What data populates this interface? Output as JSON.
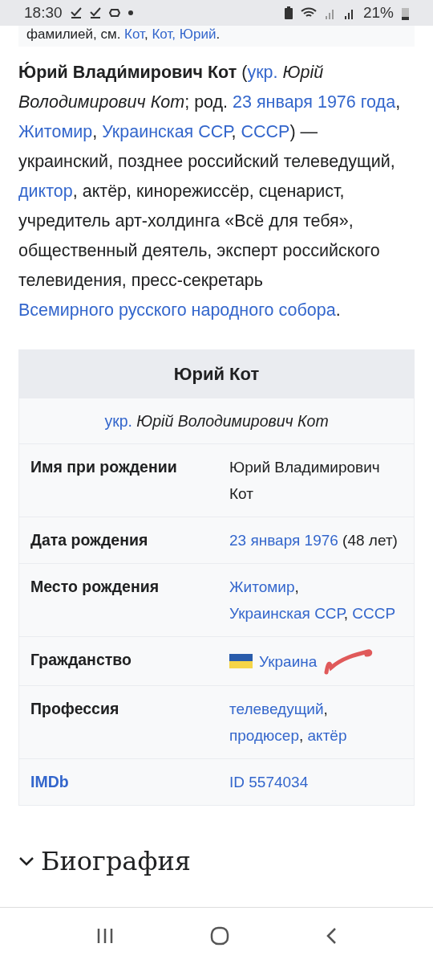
{
  "status_bar": {
    "time": "18:30",
    "battery": "21%"
  },
  "notice": [
    {
      "kind": "text",
      "t": "фамилией, см. "
    },
    {
      "kind": "link",
      "t": "Кот"
    },
    {
      "kind": "text",
      "t": ", "
    },
    {
      "kind": "link",
      "t": "Кот, Юрий"
    },
    {
      "kind": "text",
      "t": "."
    }
  ],
  "intro": [
    {
      "kind": "bold",
      "t": "Ю́рий Влади́мирович Кот"
    },
    {
      "kind": "text",
      "t": " ("
    },
    {
      "kind": "link",
      "t": "укр."
    },
    {
      "kind": "italic",
      "t": " Юрій Володимирович Кот"
    },
    {
      "kind": "text",
      "t": "; род. "
    },
    {
      "kind": "link",
      "t": "23 января 1976 года"
    },
    {
      "kind": "text",
      "t": ", "
    },
    {
      "kind": "link",
      "t": "Житомир"
    },
    {
      "kind": "text",
      "t": ", "
    },
    {
      "kind": "link",
      "t": "Украинская ССР"
    },
    {
      "kind": "text",
      "t": ", "
    },
    {
      "kind": "link",
      "t": "СССР"
    },
    {
      "kind": "text",
      "t": ") — украинский, позднее российский телеведущий, "
    },
    {
      "kind": "link",
      "t": "диктор"
    },
    {
      "kind": "text",
      "t": ", актёр, кинорежиссёр, сценарист, учредитель арт-холдинга «Всё для тебя», общественный деятель, эксперт российского телевидения, пресс-секретарь "
    },
    {
      "kind": "link",
      "t": "Всемирного русского народного собора"
    },
    {
      "kind": "text",
      "t": "."
    }
  ],
  "infobox": {
    "title": "Юрий Кот",
    "subtitle": [
      {
        "kind": "link",
        "t": "укр."
      },
      {
        "kind": "italic",
        "t": " Юрій Володимирович Кот"
      }
    ],
    "rows": [
      {
        "label": "Имя при рождении",
        "kind": "text",
        "value": [
          {
            "kind": "text",
            "t": "Юрий Владимирович Кот"
          }
        ]
      },
      {
        "label": "Дата рождения",
        "kind": "text",
        "value": [
          {
            "kind": "link",
            "t": "23 января 1976"
          },
          {
            "kind": "text",
            "t": " (48 лет)"
          }
        ]
      },
      {
        "label": "Место рождения",
        "kind": "text",
        "value": [
          {
            "kind": "link",
            "t": "Житомир"
          },
          {
            "kind": "text",
            "t": ", "
          },
          {
            "kind": "link",
            "t": "Украинская ССР"
          },
          {
            "kind": "text",
            "t": ", "
          },
          {
            "kind": "link",
            "t": "СССР"
          }
        ]
      },
      {
        "label": "Гражданство",
        "kind": "text",
        "flag": true,
        "marked": true,
        "value": [
          {
            "kind": "link",
            "t": "Украина"
          }
        ]
      },
      {
        "label": "Профессия",
        "kind": "text",
        "value": [
          {
            "kind": "link",
            "t": "телеведущий"
          },
          {
            "kind": "text",
            "t": ", "
          },
          {
            "kind": "link",
            "t": "продюсер"
          },
          {
            "kind": "text",
            "t": ", "
          },
          {
            "kind": "link",
            "t": "актёр"
          }
        ]
      },
      {
        "label": "IMDb",
        "kind": "link",
        "value": [
          {
            "kind": "link",
            "t": "ID 5574034"
          }
        ]
      }
    ]
  },
  "section": {
    "title": "Биография",
    "expanded": true
  }
}
